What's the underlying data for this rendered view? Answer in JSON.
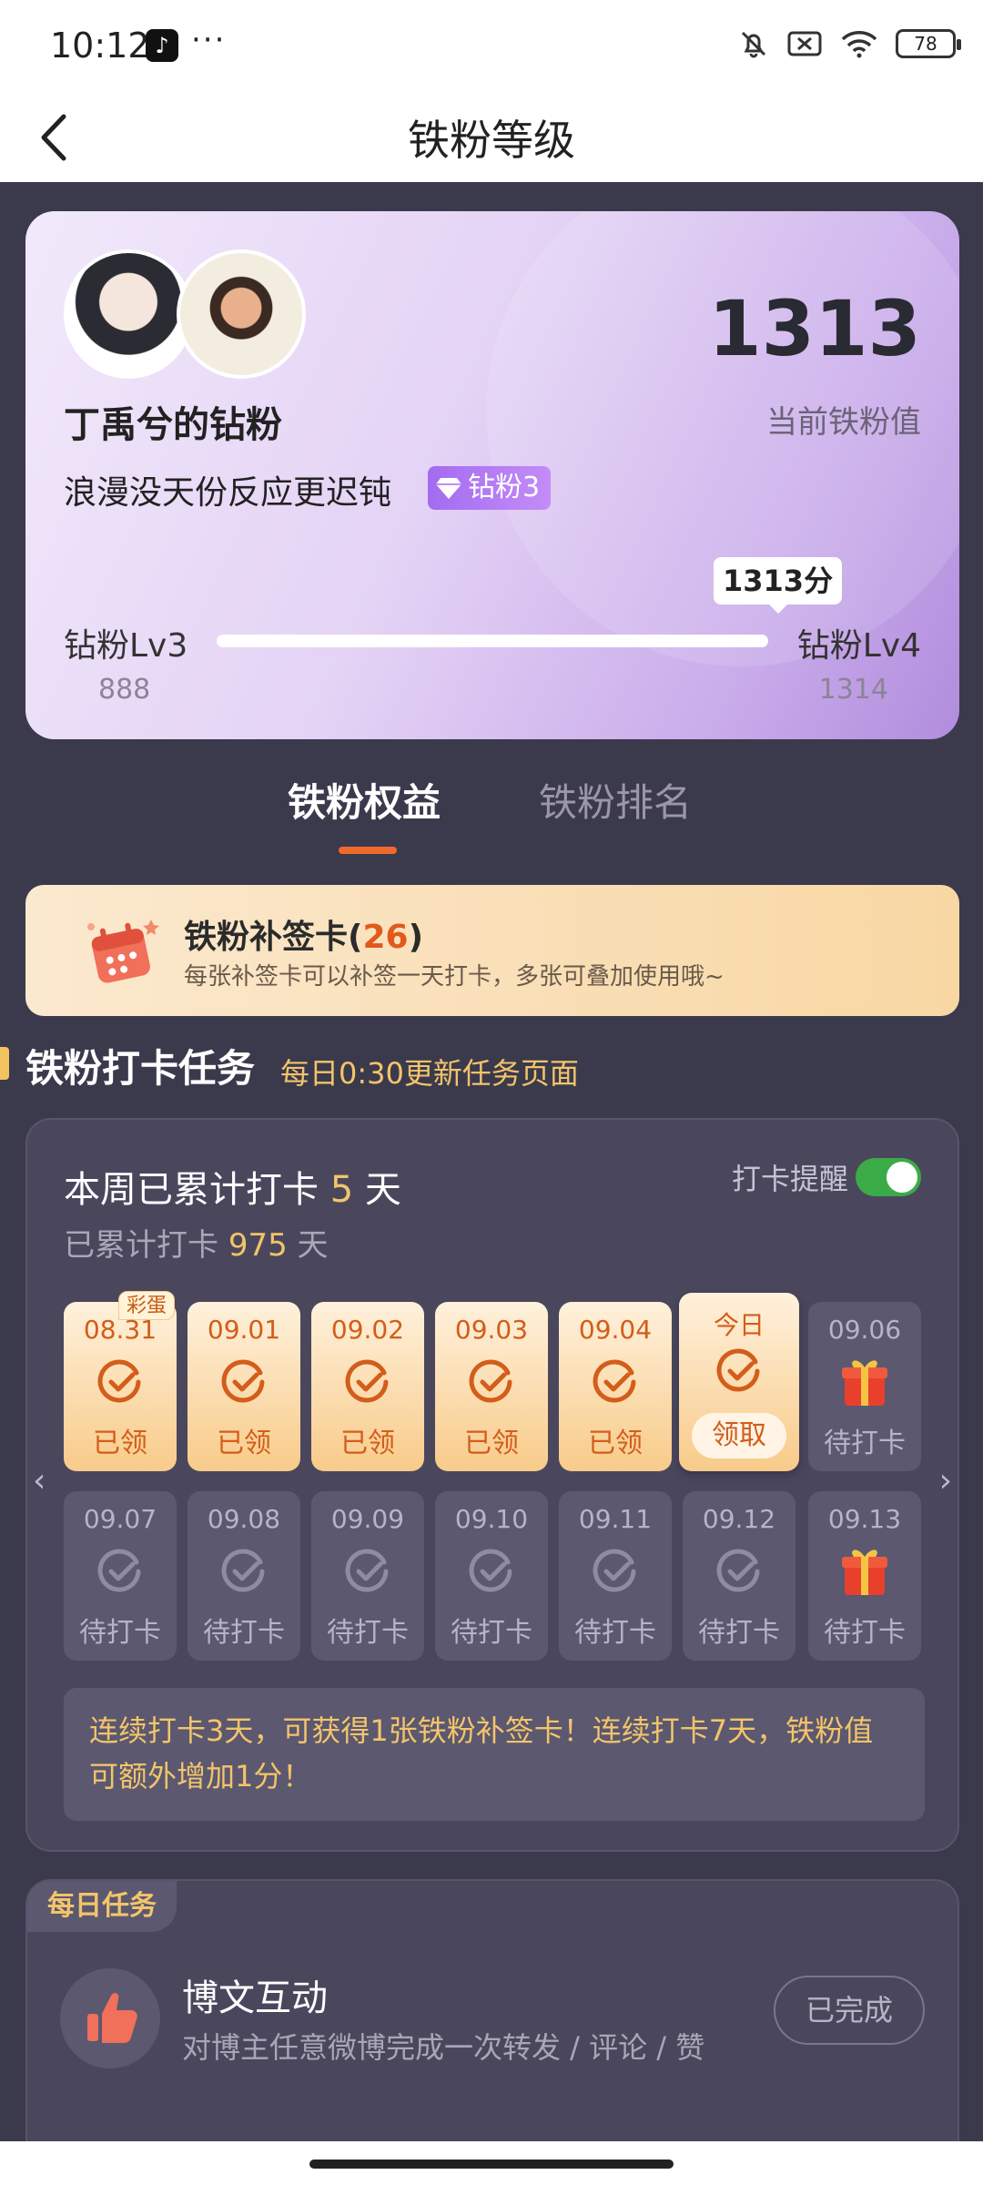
{
  "status_bar": {
    "time": "10:12",
    "more": "···",
    "battery": "78"
  },
  "nav": {
    "title": "铁粉等级"
  },
  "fan_card": {
    "owner": "丁禹兮的钻粉",
    "motto": "浪漫没天份反应更迟钝",
    "badge": "钻粉3",
    "value": "1313",
    "value_label": "当前铁粉值",
    "progress_bubble": "1313分",
    "level_current": "钻粉Lv3",
    "level_next": "钻粉Lv4",
    "points_current": "888",
    "points_next": "1314",
    "progress_fraction": 0.998
  },
  "tabs": [
    {
      "label": "铁粉权益",
      "active": true
    },
    {
      "label": "铁粉排名",
      "active": false
    }
  ],
  "makeup_card": {
    "title": "铁粉补签卡(",
    "count": "26",
    "title_end": ")",
    "desc": "每张补签卡可以补签一天打卡，多张可叠加使用哦~"
  },
  "checkin_section": {
    "title": "铁粉打卡任务",
    "subtitle": "每日0:30更新任务页面"
  },
  "checkin": {
    "week_prefix": "本周已累计打卡",
    "week_days": "5",
    "week_suffix": "天",
    "total_prefix": "已累计打卡",
    "total_days": "975",
    "total_suffix": "天",
    "remind_label": "打卡提醒",
    "remind_on": true,
    "egg_label": "彩蛋",
    "row1": [
      {
        "date": "08.31",
        "status": "已领"
      },
      {
        "date": "09.01",
        "status": "已领"
      },
      {
        "date": "09.02",
        "status": "已领"
      },
      {
        "date": "09.03",
        "status": "已领"
      },
      {
        "date": "09.04",
        "status": "已领"
      },
      {
        "date": "今日",
        "status": "领取"
      },
      {
        "date": "09.06",
        "status": "待打卡"
      }
    ],
    "row2": [
      {
        "date": "09.07",
        "status": "待打卡"
      },
      {
        "date": "09.08",
        "status": "待打卡"
      },
      {
        "date": "09.09",
        "status": "待打卡"
      },
      {
        "date": "09.10",
        "status": "待打卡"
      },
      {
        "date": "09.11",
        "status": "待打卡"
      },
      {
        "date": "09.12",
        "status": "待打卡"
      },
      {
        "date": "09.13",
        "status": "待打卡"
      }
    ],
    "notice": "连续打卡3天，可获得1张铁粉补签卡！连续打卡7天，铁粉值可额外增加1分！",
    "arrow_left": "‹",
    "arrow_right": "›"
  },
  "daily_tasks": {
    "tag": "每日任务",
    "task_title": "博文互动",
    "task_desc": "对博主任意微博完成一次转发 / 评论 / 赞",
    "task_button": "已完成"
  },
  "colors": {
    "accent_orange": "#ef6a2a",
    "gold_text": "#f3c46a",
    "page_bg": "#3b3a4d"
  }
}
